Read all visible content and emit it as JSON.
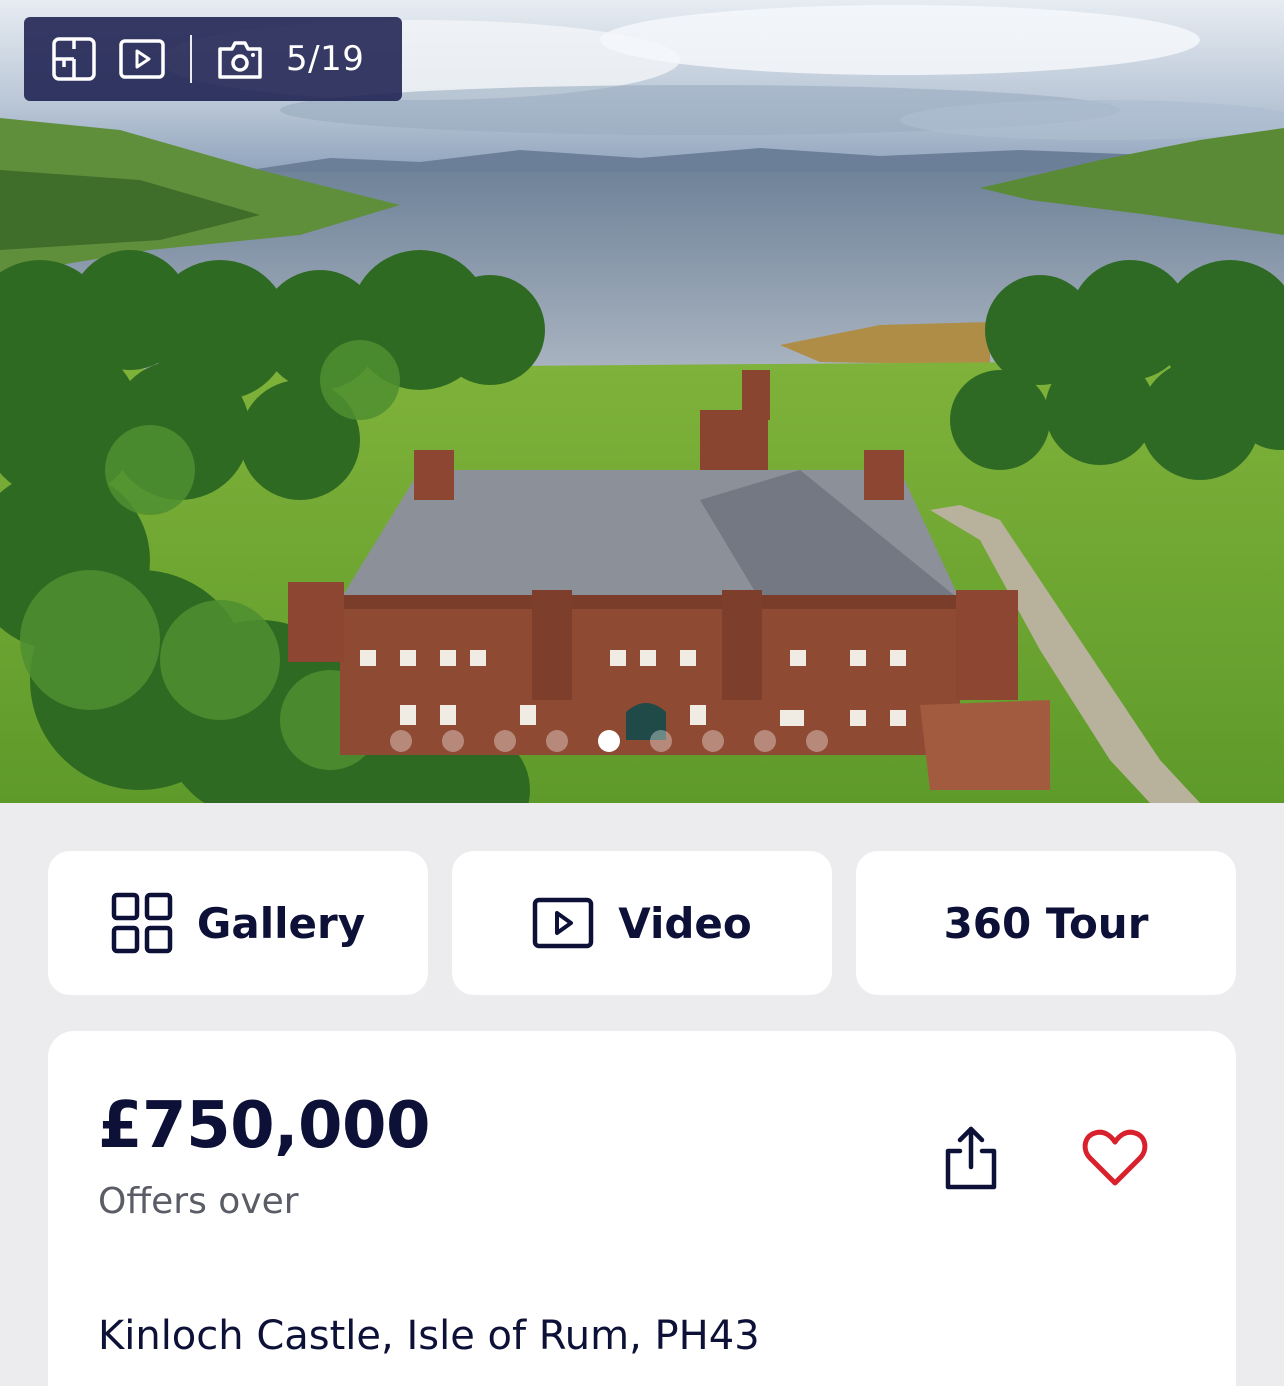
{
  "gallery": {
    "counter": "5/19",
    "icons": [
      "floorplan-icon",
      "video-icon",
      "camera-icon"
    ],
    "photo_description": "",
    "dot_count": 9,
    "active_dot": 4
  },
  "actions": [
    {
      "label": "Gallery",
      "icon": "gallery-grid-icon"
    },
    {
      "label": "Video",
      "icon": "video-icon"
    },
    {
      "label": "360 Tour",
      "icon": ""
    }
  ],
  "listing": {
    "price": "£750,000",
    "price_qualifier": "Offers over",
    "address": "Kinloch Castle, Isle of Rum, PH43"
  },
  "colors": {
    "navy": "#0d1137",
    "favourite_red": "#d8212c",
    "page_background": "#ececee"
  }
}
